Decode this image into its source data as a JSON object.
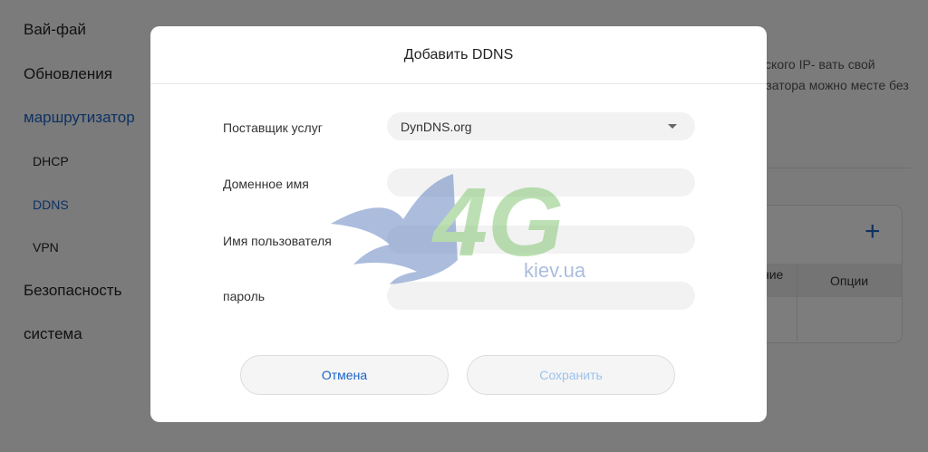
{
  "sidebar": {
    "items": [
      {
        "label": "Вай-фай"
      },
      {
        "label": "Обновления"
      },
      {
        "label": "маршрутизатор"
      },
      {
        "label": "DHCP"
      },
      {
        "label": "DDNS"
      },
      {
        "label": "VPN"
      },
      {
        "label": "Безопасность"
      },
      {
        "label": "система"
      }
    ]
  },
  "background": {
    "description": "динамического IP- вать свой маршрутизатора можно месте без",
    "table_headers": [
      "ние",
      "Опции"
    ]
  },
  "dialog": {
    "title": "Добавить DDNS",
    "fields": [
      {
        "label": "Поставщик услуг",
        "value": "DynDNS.org"
      },
      {
        "label": "Доменное имя",
        "value": ""
      },
      {
        "label": "Имя пользователя",
        "value": ""
      },
      {
        "label": "пароль",
        "value": ""
      }
    ],
    "cancel_label": "Отмена",
    "save_label": "Сохранить"
  },
  "watermark": {
    "logo": "4G",
    "sub": "kiev.ua"
  },
  "colors": {
    "accent": "#1a63c7",
    "save_disabled": "#9cc2ef",
    "watermark_green": "#7cc36a",
    "watermark_blue": "#5a7bbd"
  }
}
